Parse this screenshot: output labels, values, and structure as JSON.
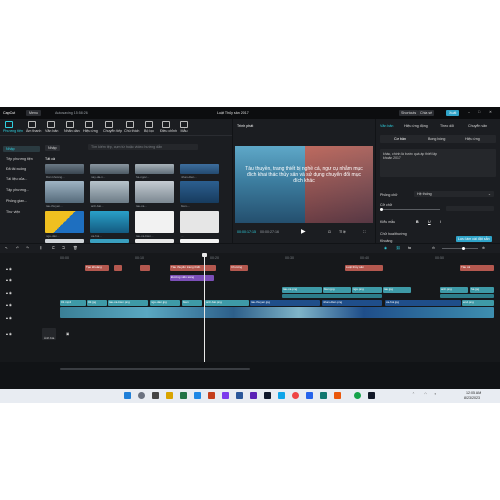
{
  "app": {
    "logo": "CapCut",
    "menu_label": "Menu",
    "autosave": "Autosaving 15:58:26",
    "project_title": "Luật Thủy sản 2017",
    "shortcuts_label": "Shortcuts",
    "share_label": "Chia sẻ",
    "export_label": "Xuất"
  },
  "toolbar": {
    "items": [
      "Phương tiện",
      "Âm thanh",
      "Văn bản",
      "Nhãn dán",
      "Hiệu ứng",
      "Chuyển tiếp",
      "Chú thích",
      "Bộ lọc",
      "Điều chỉnh",
      "Mẫu"
    ]
  },
  "media": {
    "import_label": "Nhập",
    "search_placeholder": "Tìm kiếm tệp, cụm từ hoặc video hướng dẫn",
    "all_label": "Tất cả",
    "sidebar": [
      "Nhập",
      "Tệp phương tiện",
      "Đã tải xuống",
      "Tài liệu của...",
      "Tập phương...",
      "Phông gian...",
      "Thư viện"
    ],
    "labels": [
      "Dán khoảng...",
      "nay-da-n...",
      "ha-ngoc...",
      "nhan-dien...",
      "tau-thuyen...",
      "anh-bai...",
      "tau-ca...",
      "bien-...",
      "ngu-dan...",
      "xa-hoi...",
      "tau-ca-bien...",
      "..."
    ]
  },
  "player": {
    "title": "Trình phát",
    "subtitle": "Tàu thuyền, trang thiết bị nghề cá, ngư cụ nhằm mục đích khai thác thủy sản và sử dụng chuyển đổi mục đích khác",
    "current_time": "00:00:17:15",
    "total_time": "00:00:27:16",
    "ratio": "Tỉ lệ"
  },
  "props": {
    "tabs": [
      "Văn bản",
      "Hiệu ứng động",
      "Theo dõi",
      "Chuyển văn"
    ],
    "subtabs": [
      "Cơ bản",
      "Bong bóng",
      "Hiệu ứng"
    ],
    "text_value": "khác, chính là bước quá áp thiết lập khoản 2017",
    "font_label": "Phông chữ",
    "font_value": "Hệ thống",
    "size_label": "Cỡ chữ",
    "style_label": "Kiểu mẫu",
    "case_label": "Chữ hoa/thường",
    "spacing_label": "Khoảng",
    "apply_label": "Lưu làm cài đặt sẵn"
  },
  "timeline": {
    "ticks": [
      "00:00",
      "00:10",
      "00:20",
      "00:30",
      "00:40",
      "00:50"
    ],
    "cover_label": "Ảnh bìa"
  },
  "taskbar": {
    "time": "12:05 AM",
    "date": "8/23/2023"
  },
  "colors": {
    "accent": "#2fd1e0",
    "clip_red": "#b4584f",
    "clip_purple": "#7b4fb8",
    "clip_teal": "#3e9aa7",
    "clip_blue": "#1f4e8a"
  }
}
